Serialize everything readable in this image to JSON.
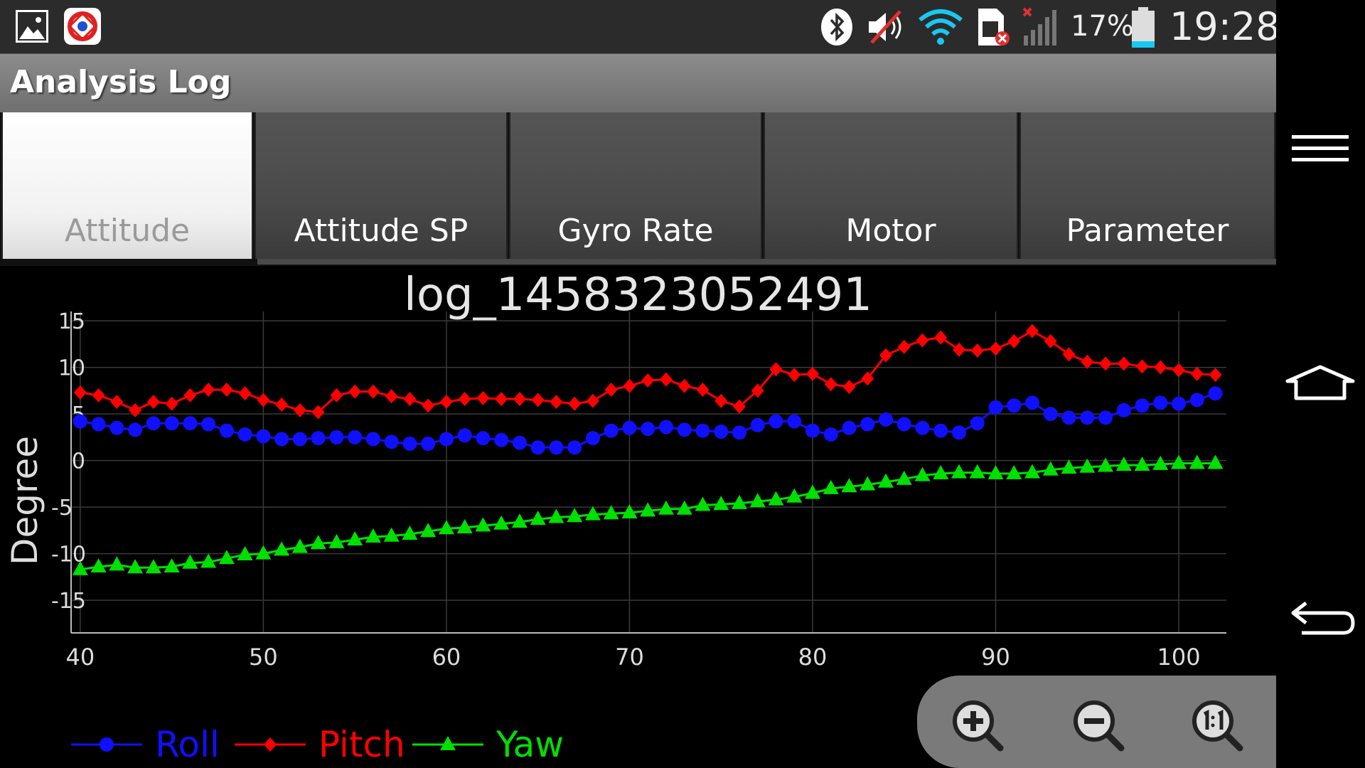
{
  "status_bar": {
    "battery_percent": "17%",
    "time": "19:28",
    "icons": [
      "gallery-icon",
      "app-icon",
      "bluetooth-icon",
      "mute-icon",
      "wifi-icon",
      "no-sim-icon",
      "signal-icon",
      "battery-icon"
    ]
  },
  "app": {
    "title": "Analysis Log"
  },
  "tabs": [
    {
      "label": "Attitude",
      "active": true
    },
    {
      "label": "Attitude SP",
      "active": false
    },
    {
      "label": "Gyro Rate",
      "active": false
    },
    {
      "label": "Motor",
      "active": false
    },
    {
      "label": "Parameter",
      "active": false
    }
  ],
  "zoom_controls": {
    "icons": [
      "zoom-in-icon",
      "zoom-out-icon",
      "zoom-reset-icon"
    ]
  },
  "nav_bar": {
    "icons": [
      "menu-icon",
      "home-icon",
      "back-icon"
    ]
  },
  "colors": {
    "roll": "#1010ff",
    "pitch": "#ff0000",
    "yaw": "#00e000",
    "grid": "#3a3a3a"
  },
  "chart_data": {
    "type": "line",
    "title": "log_1458323052491",
    "xlabel": "",
    "ylabel": "Degree",
    "xlim": [
      39.5,
      102.6
    ],
    "ylim": [
      -18.5,
      16
    ],
    "x_ticks": [
      40,
      50,
      60,
      70,
      80,
      90,
      100
    ],
    "y_ticks": [
      15,
      10,
      5,
      0,
      -5,
      -10,
      -15
    ],
    "grid": true,
    "legend_position": "bottom-left",
    "x": [
      40,
      41,
      42,
      43,
      44,
      45,
      46,
      47,
      48,
      49,
      50,
      51,
      52,
      53,
      54,
      55,
      56,
      57,
      58,
      59,
      60,
      61,
      62,
      63,
      64,
      65,
      66,
      67,
      68,
      69,
      70,
      71,
      72,
      73,
      74,
      75,
      76,
      77,
      78,
      79,
      80,
      81,
      82,
      83,
      84,
      85,
      86,
      87,
      88,
      89,
      90,
      91,
      92,
      93,
      94,
      95,
      96,
      97,
      98,
      99,
      100,
      101,
      102
    ],
    "series": [
      {
        "name": "Roll",
        "marker": "circle",
        "color": "#1010ff",
        "values": [
          4.2,
          3.9,
          3.5,
          3.3,
          4.0,
          4.0,
          4.0,
          3.9,
          3.2,
          2.8,
          2.6,
          2.3,
          2.3,
          2.4,
          2.5,
          2.5,
          2.3,
          2.0,
          1.8,
          1.8,
          2.3,
          2.7,
          2.4,
          2.2,
          1.9,
          1.4,
          1.4,
          1.4,
          2.4,
          3.2,
          3.5,
          3.4,
          3.6,
          3.3,
          3.2,
          3.1,
          3.0,
          3.8,
          4.2,
          4.2,
          3.2,
          2.8,
          3.5,
          3.9,
          4.4,
          3.9,
          3.5,
          3.2,
          3.0,
          4.0,
          5.7,
          5.9,
          6.2,
          5.0,
          4.6,
          4.6,
          4.6,
          5.4,
          5.9,
          6.2,
          6.1,
          6.5,
          7.2
        ]
      },
      {
        "name": "Pitch",
        "marker": "diamond",
        "color": "#ff0000",
        "values": [
          7.3,
          7.0,
          6.3,
          5.4,
          6.3,
          6.1,
          7.0,
          7.6,
          7.6,
          7.2,
          6.5,
          6.0,
          5.4,
          5.2,
          7.0,
          7.4,
          7.4,
          6.9,
          6.6,
          5.9,
          6.3,
          6.6,
          6.7,
          6.6,
          6.6,
          6.5,
          6.3,
          6.1,
          6.4,
          7.6,
          8.0,
          8.6,
          8.7,
          8.0,
          7.6,
          6.4,
          5.8,
          7.5,
          9.8,
          9.2,
          9.3,
          8.2,
          7.9,
          8.8,
          11.3,
          12.2,
          12.9,
          13.2,
          11.9,
          11.8,
          12.0,
          12.8,
          13.9,
          12.8,
          11.4,
          10.6,
          10.4,
          10.4,
          10.1,
          10.0,
          9.7,
          9.3,
          9.2
        ]
      },
      {
        "name": "Yaw",
        "marker": "triangle",
        "color": "#00e000",
        "values": [
          -11.7,
          -11.4,
          -11.2,
          -11.5,
          -11.5,
          -11.4,
          -11.0,
          -10.9,
          -10.5,
          -10.1,
          -10.0,
          -9.6,
          -9.3,
          -8.9,
          -8.8,
          -8.5,
          -8.2,
          -8.1,
          -7.9,
          -7.6,
          -7.3,
          -7.2,
          -7.0,
          -6.8,
          -6.6,
          -6.3,
          -6.1,
          -6.0,
          -5.8,
          -5.7,
          -5.6,
          -5.4,
          -5.2,
          -5.2,
          -4.8,
          -4.7,
          -4.6,
          -4.4,
          -4.2,
          -3.9,
          -3.5,
          -3.0,
          -2.8,
          -2.6,
          -2.3,
          -2.0,
          -1.6,
          -1.4,
          -1.3,
          -1.3,
          -1.4,
          -1.4,
          -1.3,
          -1.0,
          -0.8,
          -0.7,
          -0.6,
          -0.5,
          -0.5,
          -0.4,
          -0.3,
          -0.3,
          -0.3
        ]
      }
    ]
  }
}
